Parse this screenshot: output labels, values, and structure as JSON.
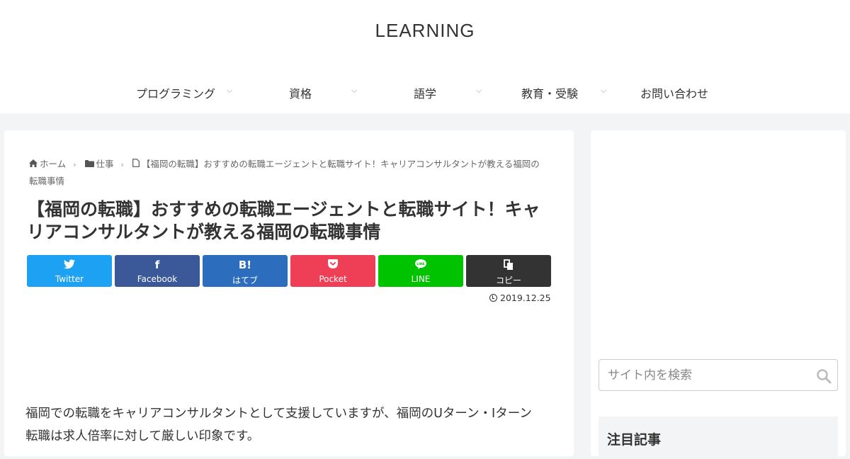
{
  "site": {
    "title": "LEARNING"
  },
  "nav": {
    "items": [
      {
        "label": "プログラミング",
        "has_submenu": true
      },
      {
        "label": "資格",
        "has_submenu": true
      },
      {
        "label": "語学",
        "has_submenu": true
      },
      {
        "label": "教育・受験",
        "has_submenu": true
      },
      {
        "label": "お問い合わせ",
        "has_submenu": false
      }
    ],
    "caret": "⌵"
  },
  "breadcrumb": {
    "home": "ホーム",
    "category": "仕事",
    "current": "【福岡の転職】おすすめの転職エージェントと転職サイト！キャリアコンサルタントが教える福岡の転職事情",
    "separator": "›"
  },
  "article": {
    "title": "【福岡の転職】おすすめの転職エージェントと転職サイト！キャリアコンサルタントが教える福岡の転職事情",
    "date": "2019.12.25",
    "body_lines": [
      "福岡での転職をキャリアコンサルタントとして支援していますが、福岡のUターン・Iターン",
      "転職は求人倍率に対して厳しい印象です。"
    ]
  },
  "share": {
    "buttons": [
      {
        "icon": "twitter-icon",
        "label": "Twitter"
      },
      {
        "icon": "facebook-icon",
        "label": "Facebook",
        "glyph": "f"
      },
      {
        "icon": "hatena-icon",
        "label": "はてブ",
        "glyph": "B!"
      },
      {
        "icon": "pocket-icon",
        "label": "Pocket"
      },
      {
        "icon": "line-icon",
        "label": "LINE"
      },
      {
        "icon": "copy-icon",
        "label": "コピー"
      }
    ],
    "colors": {
      "twitter": "#1da1f2",
      "facebook": "#3b5998",
      "hatena": "#2c6ebd",
      "pocket": "#ef3f56",
      "line": "#00c300",
      "copy": "#333333"
    }
  },
  "sidebar": {
    "search_placeholder": "サイト内を検索",
    "widget_title": "注目記事"
  }
}
